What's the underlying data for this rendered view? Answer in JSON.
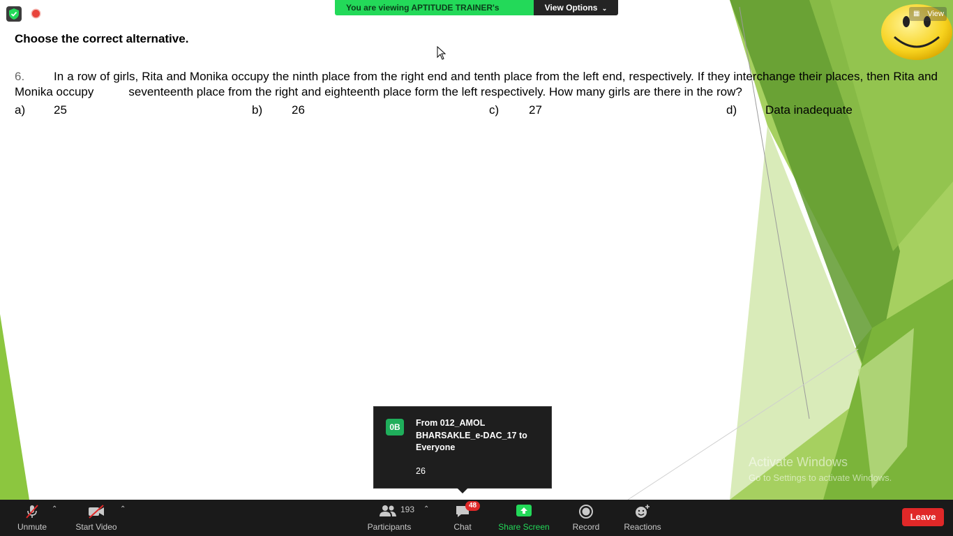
{
  "slide": {
    "heading": "Choose the correct alternative.",
    "question_number": "6.",
    "question_line1": "In a row of girls, Rita and Monika occupy the ninth place from the right end and tenth place  from the left end, respectively. If they interchange their places, then Rita and Monika occupy",
    "question_line2": "seventeenth place from the right and eighteenth place form the left respectively. How many  girls are there in the row?",
    "options": [
      {
        "label": "a)",
        "value": "25"
      },
      {
        "label": "b)",
        "value": "26"
      },
      {
        "label": "c)",
        "value": "27"
      },
      {
        "label": "d)",
        "value": "Data inadequate"
      }
    ]
  },
  "banner": {
    "viewing_text": "You are viewing APTITUDE TRAINER's screen",
    "view_options": "View Options"
  },
  "view_button": "View",
  "watermark": {
    "title": "Activate Windows",
    "subtitle": "Go to Settings to activate Windows."
  },
  "chat_notification": {
    "avatar_initials": "0B",
    "from": "From 012_AMOL BHARSAKLE_e-DAC_17 to Everyone",
    "message": "26"
  },
  "toolbar": {
    "unmute": "Unmute",
    "start_video": "Start Video",
    "participants": "Participants",
    "participant_count": "193",
    "chat": "Chat",
    "chat_badge": "48",
    "share_screen": "Share Screen",
    "record": "Record",
    "reactions": "Reactions",
    "leave": "Leave"
  },
  "colors": {
    "banner_green": "#23d959",
    "leave_red": "#e02828",
    "slide_green": "#8cc63f",
    "toolbar_bg": "#1a1a1a"
  }
}
